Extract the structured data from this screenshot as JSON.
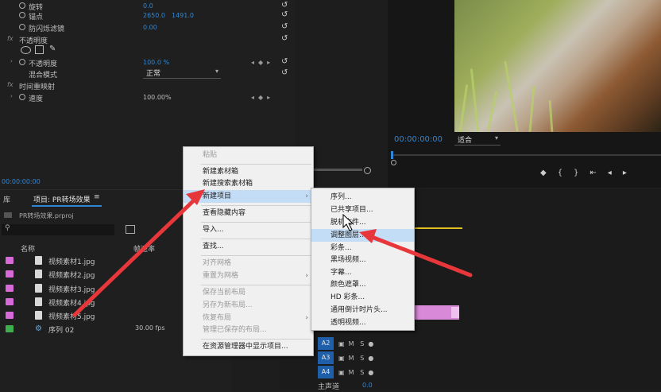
{
  "effects": {
    "rows": [
      {
        "label": "旋转",
        "value": "0.0"
      },
      {
        "label": "锚点",
        "value": "2650.0",
        "value2": "1491.0"
      },
      {
        "label": "防闪烁滤镜",
        "value": "0.00"
      },
      {
        "label": "不透明度"
      },
      {
        "label": "不透明度",
        "value": "100.0 %"
      },
      {
        "label": "混合模式",
        "value": "正常"
      },
      {
        "label": "时间重映射"
      },
      {
        "label": "速度",
        "value": "100.00%"
      }
    ],
    "timecode": "00:00:00:00"
  },
  "program": {
    "timecode": "00:00:00:00",
    "fit": "适合"
  },
  "project": {
    "tab_prefix": "库",
    "tab_label": "项目: PR转场效果",
    "tab_menu": "≡",
    "file": "PR转场效果.prproj",
    "col_name": "名称",
    "col_rate": "帧速率",
    "items": [
      {
        "name": "视频素材1.jpg",
        "color": "#d66ad6"
      },
      {
        "name": "视频素材2.jpg",
        "color": "#d66ad6"
      },
      {
        "name": "视频素材3.jpg",
        "color": "#d66ad6"
      },
      {
        "name": "视频素材4.jpg",
        "color": "#d66ad6"
      },
      {
        "name": "视频素材5.jpg",
        "color": "#d66ad6"
      },
      {
        "name": "序列 02",
        "color": "#3fae4e",
        "rate": "30.00 fps"
      }
    ]
  },
  "timeline": {
    "tracks": [
      "A2",
      "A3",
      "A4"
    ],
    "track_btns": [
      "M",
      "S"
    ],
    "master": "主声道",
    "master_val": "0.0"
  },
  "context_menu": {
    "items": [
      {
        "label": "粘贴",
        "disabled": true
      },
      {
        "label": "新建素材箱"
      },
      {
        "label": "新建搜索素材箱"
      },
      {
        "label": "新建项目",
        "highlighted": true,
        "submenu": "›"
      },
      {
        "label": "查看隐藏内容"
      },
      {
        "label": "导入..."
      },
      {
        "label": "查找..."
      },
      {
        "label": "对齐网格",
        "disabled": true
      },
      {
        "label": "重置为网格",
        "disabled": true,
        "submenu": "›"
      },
      {
        "label": "保存当前布局",
        "disabled": true
      },
      {
        "label": "另存为新布局...",
        "disabled": true
      },
      {
        "label": "恢复布局",
        "disabled": true,
        "submenu": "›"
      },
      {
        "label": "管理已保存的布局...",
        "disabled": true
      },
      {
        "label": "在资源管理器中显示项目..."
      }
    ]
  },
  "submenu": {
    "items": [
      {
        "label": "序列..."
      },
      {
        "label": "已共享项目..."
      },
      {
        "label": "脱机文件..."
      },
      {
        "label": "调整图层...",
        "highlighted": true
      },
      {
        "label": "彩条..."
      },
      {
        "label": "黑场视频..."
      },
      {
        "label": "字幕..."
      },
      {
        "label": "颜色遮罩..."
      },
      {
        "label": "HD 彩条..."
      },
      {
        "label": "通用倒计时片头..."
      },
      {
        "label": "透明视频..."
      }
    ]
  },
  "colors": {
    "accent": "#2f86d6",
    "arrow": "#e8373a",
    "highlight": "#c4ddf6"
  }
}
